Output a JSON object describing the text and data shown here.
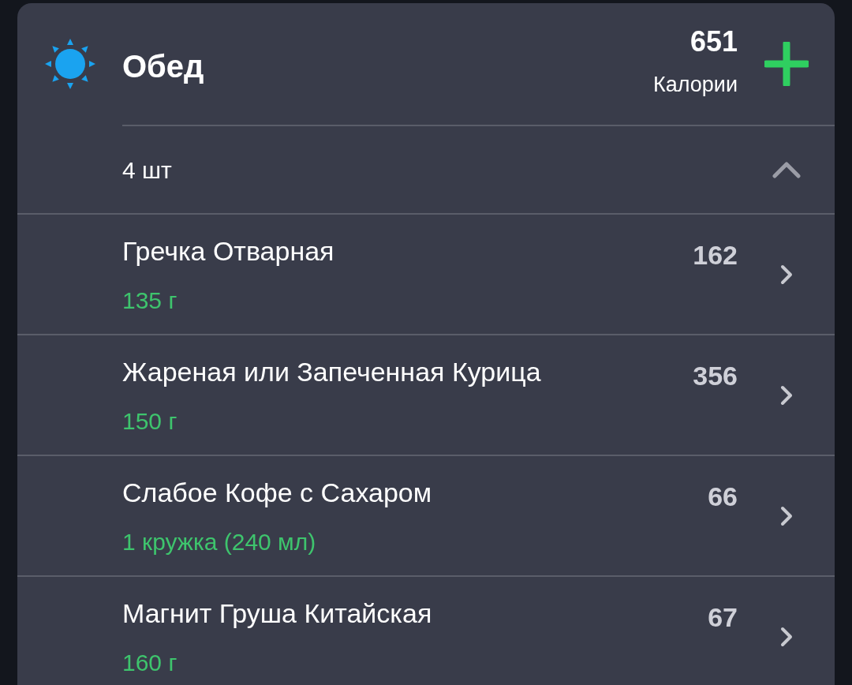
{
  "meal": {
    "title": "Обед",
    "calories": "651",
    "calories_label": "Калории",
    "count": "4 шт",
    "expanded": true
  },
  "items": [
    {
      "name": "Гречка Отварная",
      "amount": "135 г",
      "calories": "162"
    },
    {
      "name": "Жареная или Запеченная Курица",
      "amount": "150 г",
      "calories": "356"
    },
    {
      "name": "Слабое Кофе с Сахаром",
      "amount": "1 кружка (240 мл)",
      "calories": "66"
    },
    {
      "name": "Магнит Груша Китайская",
      "amount": "160 г",
      "calories": "67"
    }
  ]
}
